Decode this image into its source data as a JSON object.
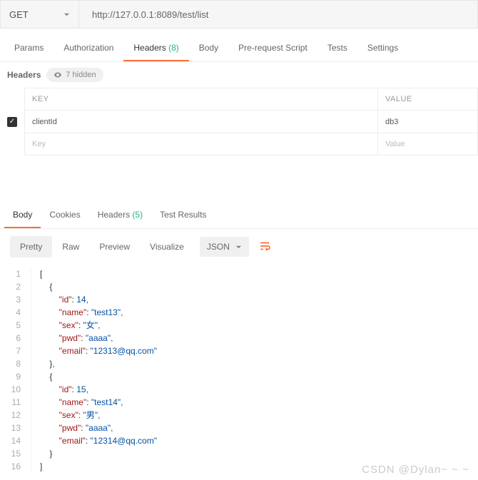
{
  "request": {
    "method": "GET",
    "url": "http://127.0.0.1:8089/test/list",
    "tabs": [
      "Params",
      "Authorization",
      "Headers",
      "Body",
      "Pre-request Script",
      "Tests",
      "Settings"
    ],
    "headers_count": "(8)",
    "active_tab": 2
  },
  "headers_section": {
    "title": "Headers",
    "hidden_label": "7 hidden",
    "columns": {
      "key": "KEY",
      "value": "VALUE"
    },
    "rows": [
      {
        "checked": true,
        "key": "clientId",
        "value": "db3"
      }
    ],
    "placeholder": {
      "key": "Key",
      "value": "Value"
    }
  },
  "response": {
    "tabs": [
      "Body",
      "Cookies",
      "Headers",
      "Test Results"
    ],
    "headers_count": "(5)",
    "active_tab": 0,
    "view_modes": [
      "Pretty",
      "Raw",
      "Preview",
      "Visualize"
    ],
    "active_view": 0,
    "format": "JSON",
    "body": [
      {
        "id": 14,
        "name": "test13",
        "sex": "女",
        "pwd": "aaaa",
        "email": "12313@qq.com"
      },
      {
        "id": 15,
        "name": "test14",
        "sex": "男",
        "pwd": "aaaa",
        "email": "12314@qq.com"
      }
    ]
  },
  "watermark": "CSDN @Dylan~ ~ ~"
}
